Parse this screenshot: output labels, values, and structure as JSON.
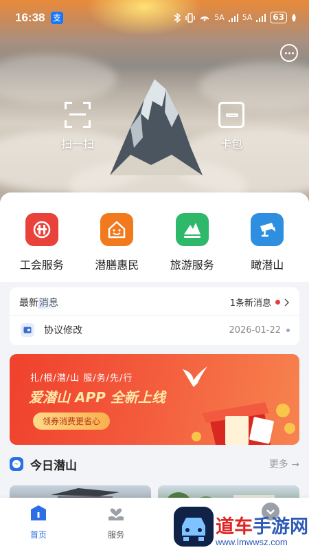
{
  "status_bar": {
    "time": "16:38",
    "alipay_glyph": "支",
    "signal_1": "5A",
    "signal_2": "5A",
    "battery": "63"
  },
  "hero": {
    "scan_label": "扫一扫",
    "wallet_label": "卡包"
  },
  "services": [
    {
      "label": "工会服务",
      "icon": "union-icon",
      "color": "#e8423a"
    },
    {
      "label": "潜膳惠民",
      "icon": "house-icon",
      "color": "#f07a1d"
    },
    {
      "label": "旅游服务",
      "icon": "mountain-icon",
      "color": "#2eb96a"
    },
    {
      "label": "瞰潜山",
      "icon": "camera-icon",
      "color": "#2e8fe0"
    }
  ],
  "news": {
    "heading_plain": "最新",
    "heading_highlight": "消息",
    "count_text": "1条新消息",
    "item_title": "协议修改",
    "item_date": "2026-01-22"
  },
  "banner": {
    "tagline": "扎/根/潜/山  服/务/先/行",
    "headline": "爱潜山 APP 全新上线",
    "pill": "领券消费更省心"
  },
  "today": {
    "title": "今日潜山",
    "more": "更多 →"
  },
  "nav": {
    "home": "首页",
    "service": "服务"
  },
  "watermark": {
    "text_red": "道车",
    "text_blue": "手游网",
    "url": "www.lmwwsz.com"
  },
  "colors": {
    "accent": "#2b6ee8",
    "banner_red": "#f0412d"
  }
}
